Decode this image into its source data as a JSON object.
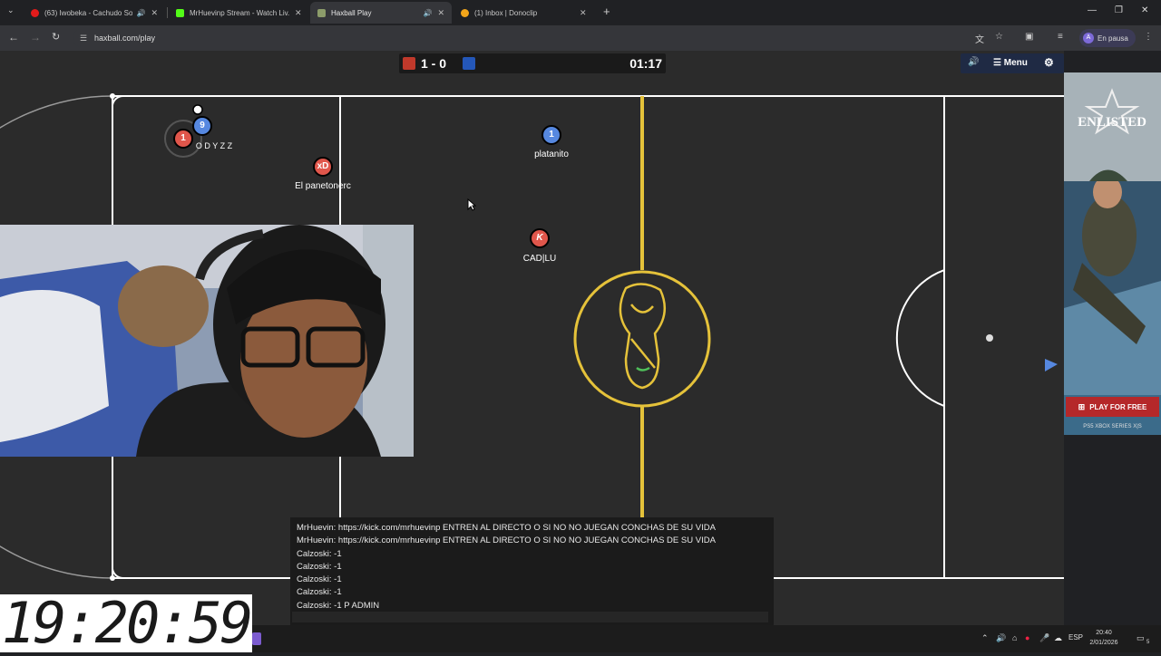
{
  "browser": {
    "tabs": [
      {
        "title": "(63) Iwobeka - Cachudo So...",
        "favicon_color": "#e21b1b"
      },
      {
        "title": "MrHuevinp Stream - Watch Liv...",
        "favicon_color": "#53fc18"
      },
      {
        "title": "Haxball Play",
        "favicon_color": "#8c9c6a"
      },
      {
        "title": "(1) Inbox | Donoclip",
        "favicon_color": "#f2a51a"
      }
    ],
    "url": "haxball.com/play",
    "profile_initial": "A",
    "profile_label": "En pausa"
  },
  "game": {
    "score": "1 - 0",
    "time": "01:17",
    "menu_label": "Menu",
    "team_colors": {
      "red": "#e0564b",
      "blue": "#5688e0"
    },
    "players": [
      {
        "avatar": "1",
        "team": "red",
        "name": ""
      },
      {
        "avatar": "9",
        "team": "blue",
        "name": "O D Y Z Z"
      },
      {
        "avatar": "1",
        "team": "blue",
        "name": "platanito"
      },
      {
        "avatar": "xD",
        "team": "red",
        "name": "El panetonerc"
      },
      {
        "avatar": "K",
        "team": "red",
        "name": "CAD|LU"
      }
    ]
  },
  "chat": {
    "messages": [
      "MrHuevin: https://kick.com/mrhuevinp ENTREN AL DIRECTO O SI NO NO JUEGAN CONCHAS DE SU VIDA",
      "MrHuevin: https://kick.com/mrhuevinp ENTREN AL DIRECTO O SI NO NO JUEGAN CONCHAS DE SU VIDA",
      "Calzoski: -1",
      "Calzoski: -1",
      "Calzoski: -1",
      "Calzoski: -1",
      "Calzoski: -1 P ADMIN"
    ]
  },
  "ad": {
    "brand": "ENLISTED",
    "cta": "PLAY FOR FREE",
    "platforms": "PS5  XBOX SERIES X|S"
  },
  "overlay_clock": "19:20:59",
  "taskbar": {
    "lang": "ESP",
    "time": "20:40",
    "date": "2/01/2026",
    "notif_count": "5"
  }
}
